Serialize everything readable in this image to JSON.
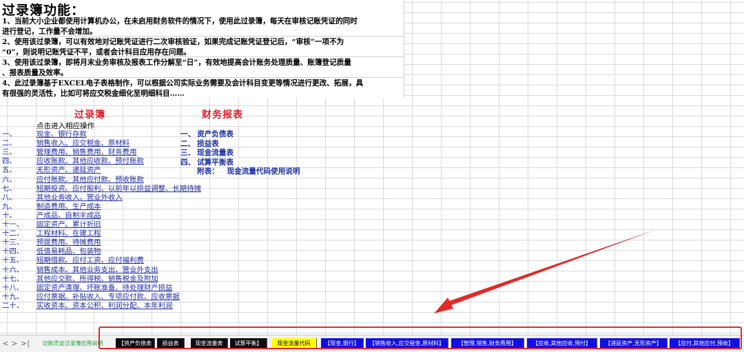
{
  "intro": {
    "title": "过录簿功能：",
    "paragraphs": [
      [
        "1、当前大小企业都使用计算机办公，在未启用财务软件的情况下，使用此过录簿，每天在审核记账凭证的同时",
        "进行登记，工作量不会增加。"
      ],
      [
        "2、使用该过录簿，可以有效地对记账凭证进行二次审核验证，如果完成记账凭证登记后，“审核”一项不为",
        "“0”，则说明记账凭证不平，或者会计科目应用存在问题。"
      ],
      [
        "3、使用该过录簿，即将月末业务审核及报表工作分解至“日”，有效地提高会计账务处理质量、账簿登记质量",
        "、报表质量及效率。"
      ],
      [
        "4、此过录簿基于EXCEL电子表格制作，可以根据公司实际业务需要及会计科目变更等情况进行更改、拓展，具",
        "有很强的灵活性，比如可将应交税金细化至明细科目……"
      ]
    ]
  },
  "ledger": {
    "heading": "过录簿",
    "hint": "点击进入相应操作",
    "items": [
      {
        "num": "一、",
        "label": "现金、银行存款"
      },
      {
        "num": "二、",
        "label": "销售收入、应交税金、原材料"
      },
      {
        "num": "三、",
        "label": "管理费用、销售费用、财务费用"
      },
      {
        "num": "四、",
        "label": "应收账款、其他应收款、预付账款"
      },
      {
        "num": "五、",
        "label": "无形资产、递延资产"
      },
      {
        "num": "六、",
        "label": "应付账款、其他应付款、预收账款"
      },
      {
        "num": "七、",
        "label": "短期投资、应付股利、以前年以损益调整、长期待摊"
      },
      {
        "num": "八、",
        "label": "其他业务收入、营业外收入"
      },
      {
        "num": "九、",
        "label": "制造费用、生产成本"
      },
      {
        "num": "十、",
        "label": "产成品、自制半成品"
      },
      {
        "num": "十一、",
        "label": "固定资产、累计折旧"
      },
      {
        "num": "十二、",
        "label": "工程材料、在建工程"
      },
      {
        "num": "十三、",
        "label": "预提费用、待摊费用"
      },
      {
        "num": "十四、",
        "label": "低值易耗品、包装物"
      },
      {
        "num": "十五、",
        "label": "短期借款、应付工资、应付福利费"
      },
      {
        "num": "十六、",
        "label": "销售成本、其他业务支出、营业外支出"
      },
      {
        "num": "十七、",
        "label": "其他应交款、所得税、销售税金及附加"
      },
      {
        "num": "十八、",
        "label": "固定资产清理、坏账准备、待处理财产损益"
      },
      {
        "num": "十九、",
        "label": "应付票据、补贴收入、专项应付款、应收票据"
      },
      {
        "num": "二十、",
        "label": "实收资本、资本公积、利润分配、本年利润"
      }
    ]
  },
  "reports": {
    "heading": "财务报表",
    "items": [
      {
        "num": "一、",
        "label": "资产负债表"
      },
      {
        "num": "二、",
        "label": "损益表"
      },
      {
        "num": "三、",
        "label": "现金流量表"
      },
      {
        "num": "四、",
        "label": "试算平衡表"
      }
    ],
    "appendix_label": "附表：",
    "appendix_link": "现金流量代码使用说明"
  },
  "sheet_nav": {
    "first": "<",
    "next": ">",
    "last": ">|"
  },
  "tabs": [
    {
      "label": "记账凭证过录簿应用说明",
      "style": "active"
    },
    {
      "label": "【资产负债表",
      "style": "black"
    },
    {
      "label": "损益表",
      "style": "black"
    },
    {
      "label": "现金流量表",
      "style": "black"
    },
    {
      "label": "试算平衡】",
      "style": "black"
    },
    {
      "label": "现金流量代码",
      "style": "yellow"
    },
    {
      "label": "【现金,银行】",
      "style": "blue"
    },
    {
      "label": "【销售收入,应交税金,原材料】",
      "style": "blue"
    },
    {
      "label": "【管理,销售,财务费用】",
      "style": "blue"
    },
    {
      "label": "【应收,其他应收,预付】",
      "style": "blue"
    },
    {
      "label": "【递延资产,无形资产】",
      "style": "blue"
    },
    {
      "label": "【应付,其他应付,预收】",
      "style": "blue"
    }
  ],
  "colors": {
    "heading_red": "#e0202a",
    "link_blue": "#1f2d9c",
    "tab_black": "#0d0d0d",
    "tab_yellow": "#ffff00",
    "tab_blue": "#1010e0",
    "active_tab_green": "#1a9a3c",
    "annotation_red": "#e32929"
  },
  "icons": [
    "first-sheet-icon",
    "next-sheet-icon",
    "last-sheet-icon",
    "annotation-arrow-icon"
  ]
}
